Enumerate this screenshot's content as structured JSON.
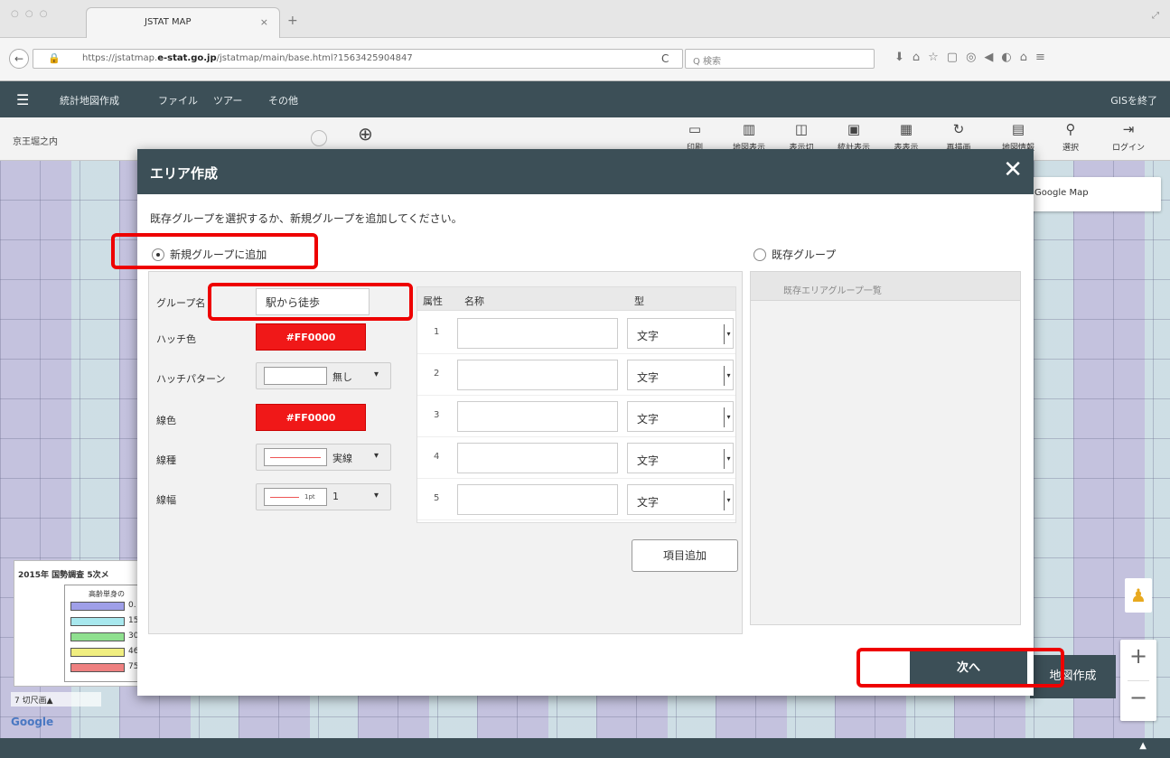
{
  "browser": {
    "tab_title": "JSTAT MAP",
    "url_prefix": "https://jstatmap.",
    "url_domain": "e-stat.go.jp",
    "url_path": "/jstatmap/main/base.html?1563425904847",
    "search_placeholder": "Q 検索"
  },
  "app": {
    "menu": [
      "統計地図作成",
      "ファイル",
      "ツアー",
      "その他"
    ],
    "exit_label": "GISを終了",
    "location": "京王堀之内",
    "tools": [
      "印刷",
      "地図表示",
      "表示切",
      "統計表示",
      "表表示",
      "再描画",
      "地図情報",
      "選択",
      "ログイン"
    ]
  },
  "map": {
    "google_map_label": "Google Map",
    "legend_title": "2015年 国勢調査 5次メ",
    "legend_sub": "高齢単身の",
    "legend_values": [
      "0.",
      "15",
      "30",
      "46",
      "75"
    ],
    "legend_colors": [
      "#9f9fe8",
      "#a8e8ee",
      "#8fe08f",
      "#f0ee80",
      "#ee8080"
    ],
    "bottom_label": "7 切尺画▲",
    "google_logo": "Google",
    "map_create_label": "地図作成"
  },
  "dialog": {
    "title": "エリア作成",
    "instruction": "既存グループを選択するか、新規グループを追加してください。",
    "radio_new": "新規グループに追加",
    "radio_existing": "既存グループ",
    "existing_list_header": "既存エリアグループ一覧",
    "labels": {
      "group_name": "グループ名",
      "hatch_color": "ハッチ色",
      "hatch_pattern": "ハッチパターン",
      "line_color": "線色",
      "line_type": "線種",
      "line_width": "線幅"
    },
    "group_name_value": "駅から徒歩",
    "hatch_color_value": "#FF0000",
    "hatch_pattern_value": "無し",
    "line_color_value": "#FF0000",
    "line_type_value": "実線",
    "line_width_value": "1",
    "line_width_unit": "1pt",
    "table_headers": [
      "属性",
      "名称",
      "型"
    ],
    "rows": [
      {
        "no": "1",
        "type": "文字"
      },
      {
        "no": "2",
        "type": "文字"
      },
      {
        "no": "3",
        "type": "文字"
      },
      {
        "no": "4",
        "type": "文字"
      },
      {
        "no": "5",
        "type": "文字"
      }
    ],
    "add_item_label": "項目追加",
    "next_label": "次へ"
  },
  "colors": {
    "header_bg": "#3c4f57",
    "swatch_red": "#f01818",
    "highlight": "#ee0000"
  }
}
